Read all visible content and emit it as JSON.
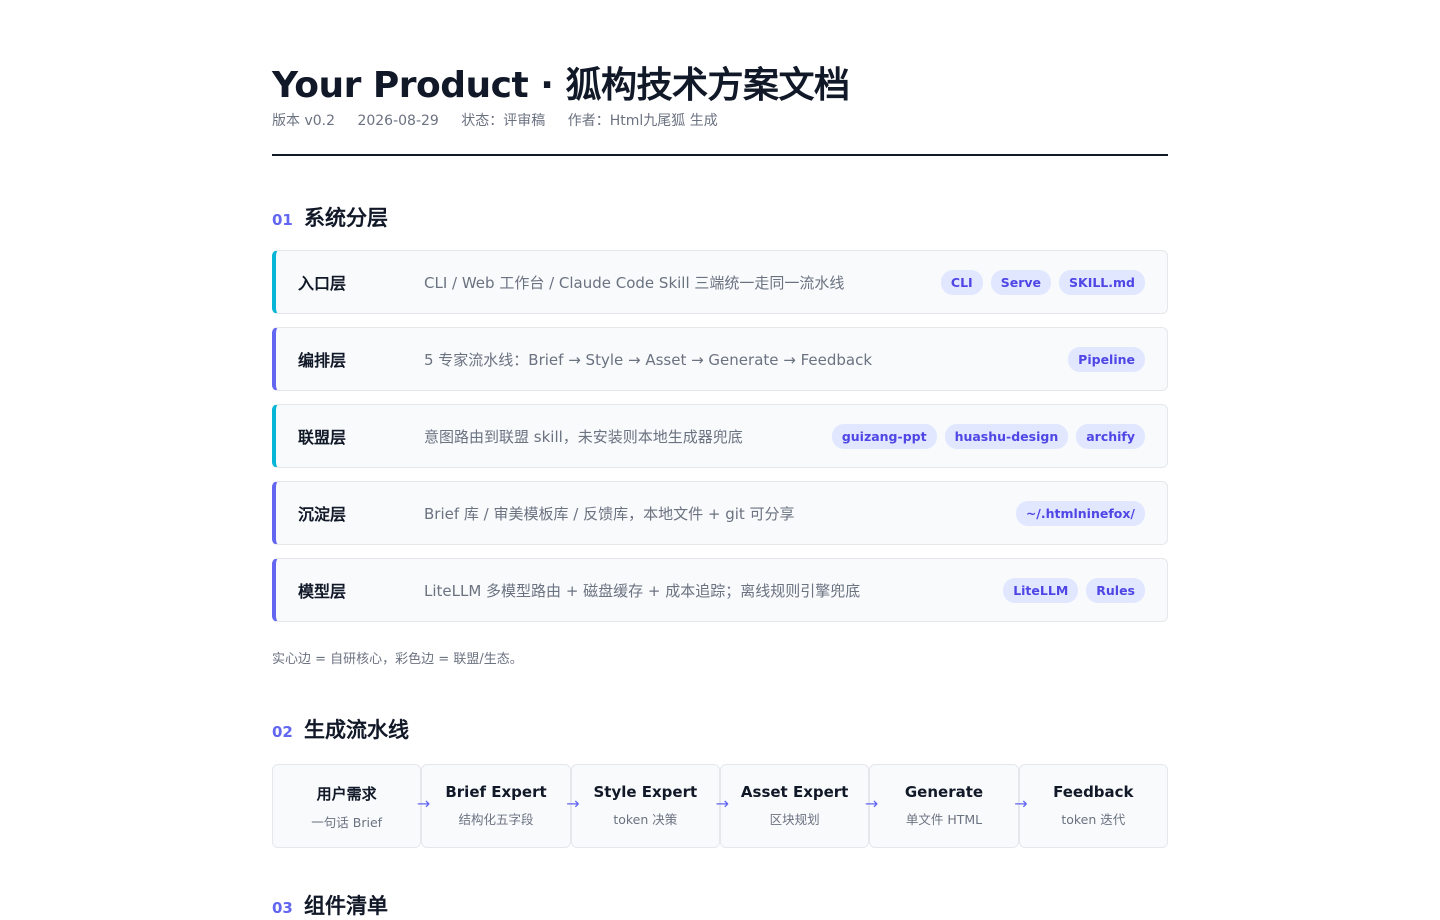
{
  "title": "Your Product · 狐构技术方案文档",
  "meta": {
    "version": "版本 v0.2",
    "date": "2026-08-29",
    "status": "状态：评审稿",
    "author": "作者：Html九尾狐 生成"
  },
  "sections": [
    {
      "num": "01",
      "title": "系统分层"
    },
    {
      "num": "02",
      "title": "生成流水线"
    },
    {
      "num": "03",
      "title": "组件清单"
    }
  ],
  "layers": [
    {
      "name": "入口层",
      "desc": "CLI / Web 工作台 / Claude Code Skill 三端统一走同一流水线",
      "tags": [
        "CLI",
        "Serve",
        "SKILL.md"
      ],
      "accent": "#06b6d4"
    },
    {
      "name": "编排层",
      "desc": "5 专家流水线：Brief → Style → Asset → Generate → Feedback",
      "tags": [
        "Pipeline"
      ],
      "accent": "#6366f1"
    },
    {
      "name": "联盟层",
      "desc": "意图路由到联盟 skill，未安装则本地生成器兜底",
      "tags": [
        "guizang-ppt",
        "huashu-design",
        "archify"
      ],
      "accent": "#06b6d4"
    },
    {
      "name": "沉淀层",
      "desc": "Brief 库 / 审美模板库 / 反馈库，本地文件 + git 可分享",
      "tags": [
        "~/.htmlninefox/"
      ],
      "accent": "#6366f1"
    },
    {
      "name": "模型层",
      "desc": "LiteLLM 多模型路由 + 磁盘缓存 + 成本追踪；离线规则引擎兜底",
      "tags": [
        "LiteLLM",
        "Rules"
      ],
      "accent": "#6366f1"
    }
  ],
  "layer_note": "实心边 = 自研核心，彩色边 = 联盟/生态。",
  "pipeline": [
    {
      "title": "用户需求",
      "sub": "一句话 Brief"
    },
    {
      "title": "Brief Expert",
      "sub": "结构化五字段"
    },
    {
      "title": "Style Expert",
      "sub": "token 决策"
    },
    {
      "title": "Asset Expert",
      "sub": "区块规划"
    },
    {
      "title": "Generate",
      "sub": "单文件 HTML"
    },
    {
      "title": "Feedback",
      "sub": "token 迭代"
    }
  ],
  "arrow_glyph": "→",
  "colors": {
    "accent": "#6366f1",
    "accent_alt": "#06b6d4",
    "tag_bg": "#e0e7ff",
    "card_bg": "#f8fafc"
  }
}
